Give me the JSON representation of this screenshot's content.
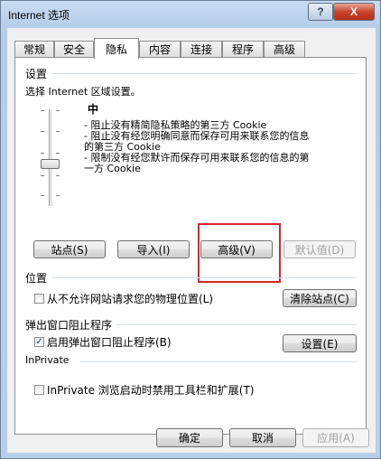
{
  "window": {
    "title": "Internet 选项",
    "help": "?",
    "close": "X"
  },
  "tabs": [
    {
      "label": "常规"
    },
    {
      "label": "安全"
    },
    {
      "label": "隐私"
    },
    {
      "label": "内容"
    },
    {
      "label": "连接"
    },
    {
      "label": "程序"
    },
    {
      "label": "高级"
    }
  ],
  "active_tab": "隐私",
  "settings": {
    "group": "设置",
    "prompt": "选择 Internet 区域设置。",
    "level": "中",
    "descriptions": [
      "- 阻止没有精简隐私策略的第三方 Cookie",
      "- 阻止没有经您明确同意而保存可用来联系您的信息",
      "的第三方 Cookie",
      "- 限制没有经您默许而保存可用来联系您的信息的第",
      "一方 Cookie"
    ],
    "buttons": {
      "sites": "站点(S)",
      "import": "导入(I)",
      "advanced": "高级(V)",
      "default": "默认值(D)"
    }
  },
  "location": {
    "group": "位置",
    "checkbox_label": "从不允许网站请求您的物理位置(L)",
    "checked": false,
    "clear_button": "清除站点(C)"
  },
  "popup": {
    "group": "弹出窗口阻止程序",
    "checkbox_label": "启用弹出窗口阻止程序(B)",
    "checked": true,
    "settings_button": "设置(E)"
  },
  "inprivate": {
    "group": "InPrivate",
    "checkbox_label": "InPrivate 浏览启动时禁用工具栏和扩展(T)",
    "checked": false
  },
  "footer": {
    "ok": "确定",
    "cancel": "取消",
    "apply": "应用(A)"
  },
  "check_glyph": "✓"
}
